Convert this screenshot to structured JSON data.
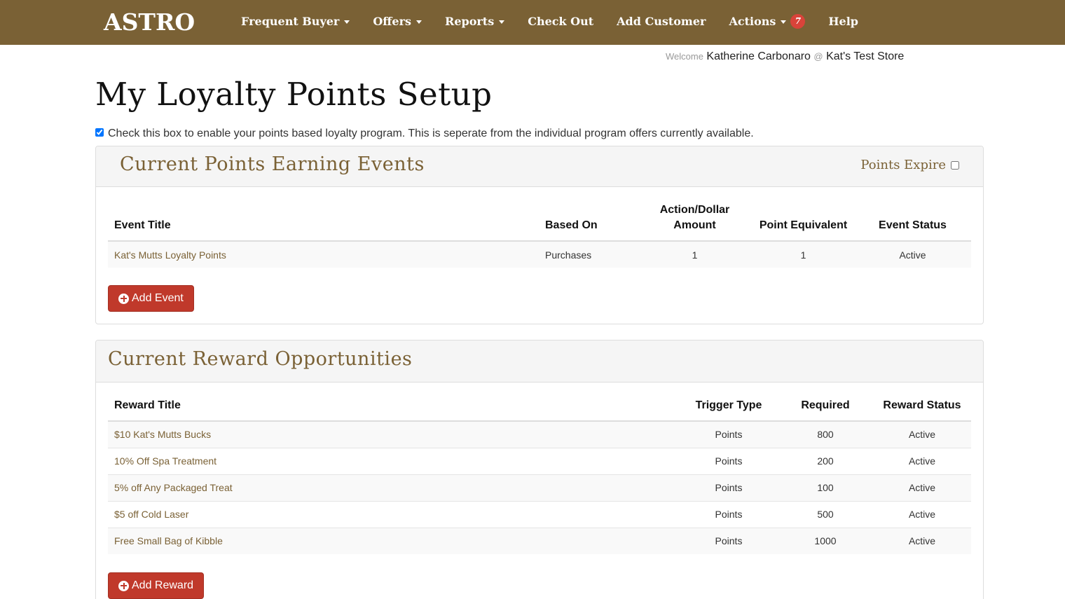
{
  "nav": {
    "logo": "ASTRO",
    "items": [
      {
        "label": "Frequent Buyer",
        "has_caret": true
      },
      {
        "label": "Offers",
        "has_caret": true
      },
      {
        "label": "Reports",
        "has_caret": true
      },
      {
        "label": "Check Out",
        "has_caret": false
      },
      {
        "label": "Add Customer",
        "has_caret": false
      },
      {
        "label": "Actions",
        "has_caret": true,
        "badge": "7"
      },
      {
        "label": "Help",
        "has_caret": false
      }
    ]
  },
  "welcome": {
    "prefix": "Welcome",
    "user": "Katherine Carbonaro",
    "at": "@",
    "store": "Kat's Test Store"
  },
  "page": {
    "title": "My Loyalty Points Setup",
    "enable_label": "Check this box to enable your points based loyalty program. This is seperate from the individual program offers currently available.",
    "enable_checked": true
  },
  "events_panel": {
    "title": "Current Points Earning Events",
    "expire_label": "Points Expire",
    "expire_checked": false,
    "headers": {
      "title": "Event Title",
      "based_on": "Based On",
      "amount_line1": "Action/Dollar",
      "amount_line2": "Amount",
      "points": "Point Equivalent",
      "status": "Event Status"
    },
    "rows": [
      {
        "title": "Kat's Mutts Loyalty Points",
        "based_on": "Purchases",
        "amount": "1",
        "points": "1",
        "status": "Active"
      }
    ],
    "add_button": "Add Event"
  },
  "rewards_panel": {
    "title": "Current Reward Opportunities",
    "headers": {
      "title": "Reward Title",
      "trigger": "Trigger Type",
      "required": "Required",
      "status": "Reward Status"
    },
    "rows": [
      {
        "title": "$10 Kat's Mutts Bucks",
        "trigger": "Points",
        "required": "800",
        "status": "Active"
      },
      {
        "title": "10% Off Spa Treatment",
        "trigger": "Points",
        "required": "200",
        "status": "Active"
      },
      {
        "title": "5% off Any Packaged Treat",
        "trigger": "Points",
        "required": "100",
        "status": "Active"
      },
      {
        "title": "$5 off Cold Laser",
        "trigger": "Points",
        "required": "500",
        "status": "Active"
      },
      {
        "title": "Free Small Bag of Kibble",
        "trigger": "Points",
        "required": "1000",
        "status": "Active"
      }
    ],
    "add_button": "Add Reward"
  },
  "colors": {
    "navbar": "#7a6135",
    "accent": "#7a6135",
    "button": "#c0392b",
    "badge": "#d9433a"
  }
}
